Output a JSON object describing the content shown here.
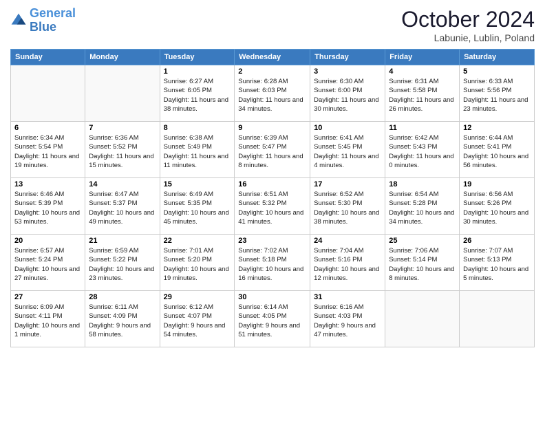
{
  "logo": {
    "line1": "General",
    "line2": "Blue"
  },
  "title": "October 2024",
  "location": "Labunie, Lublin, Poland",
  "weekdays": [
    "Sunday",
    "Monday",
    "Tuesday",
    "Wednesday",
    "Thursday",
    "Friday",
    "Saturday"
  ],
  "weeks": [
    [
      {
        "day": "",
        "info": ""
      },
      {
        "day": "",
        "info": ""
      },
      {
        "day": "1",
        "info": "Sunrise: 6:27 AM\nSunset: 6:05 PM\nDaylight: 11 hours and 38 minutes."
      },
      {
        "day": "2",
        "info": "Sunrise: 6:28 AM\nSunset: 6:03 PM\nDaylight: 11 hours and 34 minutes."
      },
      {
        "day": "3",
        "info": "Sunrise: 6:30 AM\nSunset: 6:00 PM\nDaylight: 11 hours and 30 minutes."
      },
      {
        "day": "4",
        "info": "Sunrise: 6:31 AM\nSunset: 5:58 PM\nDaylight: 11 hours and 26 minutes."
      },
      {
        "day": "5",
        "info": "Sunrise: 6:33 AM\nSunset: 5:56 PM\nDaylight: 11 hours and 23 minutes."
      }
    ],
    [
      {
        "day": "6",
        "info": "Sunrise: 6:34 AM\nSunset: 5:54 PM\nDaylight: 11 hours and 19 minutes."
      },
      {
        "day": "7",
        "info": "Sunrise: 6:36 AM\nSunset: 5:52 PM\nDaylight: 11 hours and 15 minutes."
      },
      {
        "day": "8",
        "info": "Sunrise: 6:38 AM\nSunset: 5:49 PM\nDaylight: 11 hours and 11 minutes."
      },
      {
        "day": "9",
        "info": "Sunrise: 6:39 AM\nSunset: 5:47 PM\nDaylight: 11 hours and 8 minutes."
      },
      {
        "day": "10",
        "info": "Sunrise: 6:41 AM\nSunset: 5:45 PM\nDaylight: 11 hours and 4 minutes."
      },
      {
        "day": "11",
        "info": "Sunrise: 6:42 AM\nSunset: 5:43 PM\nDaylight: 11 hours and 0 minutes."
      },
      {
        "day": "12",
        "info": "Sunrise: 6:44 AM\nSunset: 5:41 PM\nDaylight: 10 hours and 56 minutes."
      }
    ],
    [
      {
        "day": "13",
        "info": "Sunrise: 6:46 AM\nSunset: 5:39 PM\nDaylight: 10 hours and 53 minutes."
      },
      {
        "day": "14",
        "info": "Sunrise: 6:47 AM\nSunset: 5:37 PM\nDaylight: 10 hours and 49 minutes."
      },
      {
        "day": "15",
        "info": "Sunrise: 6:49 AM\nSunset: 5:35 PM\nDaylight: 10 hours and 45 minutes."
      },
      {
        "day": "16",
        "info": "Sunrise: 6:51 AM\nSunset: 5:32 PM\nDaylight: 10 hours and 41 minutes."
      },
      {
        "day": "17",
        "info": "Sunrise: 6:52 AM\nSunset: 5:30 PM\nDaylight: 10 hours and 38 minutes."
      },
      {
        "day": "18",
        "info": "Sunrise: 6:54 AM\nSunset: 5:28 PM\nDaylight: 10 hours and 34 minutes."
      },
      {
        "day": "19",
        "info": "Sunrise: 6:56 AM\nSunset: 5:26 PM\nDaylight: 10 hours and 30 minutes."
      }
    ],
    [
      {
        "day": "20",
        "info": "Sunrise: 6:57 AM\nSunset: 5:24 PM\nDaylight: 10 hours and 27 minutes."
      },
      {
        "day": "21",
        "info": "Sunrise: 6:59 AM\nSunset: 5:22 PM\nDaylight: 10 hours and 23 minutes."
      },
      {
        "day": "22",
        "info": "Sunrise: 7:01 AM\nSunset: 5:20 PM\nDaylight: 10 hours and 19 minutes."
      },
      {
        "day": "23",
        "info": "Sunrise: 7:02 AM\nSunset: 5:18 PM\nDaylight: 10 hours and 16 minutes."
      },
      {
        "day": "24",
        "info": "Sunrise: 7:04 AM\nSunset: 5:16 PM\nDaylight: 10 hours and 12 minutes."
      },
      {
        "day": "25",
        "info": "Sunrise: 7:06 AM\nSunset: 5:14 PM\nDaylight: 10 hours and 8 minutes."
      },
      {
        "day": "26",
        "info": "Sunrise: 7:07 AM\nSunset: 5:13 PM\nDaylight: 10 hours and 5 minutes."
      }
    ],
    [
      {
        "day": "27",
        "info": "Sunrise: 6:09 AM\nSunset: 4:11 PM\nDaylight: 10 hours and 1 minute."
      },
      {
        "day": "28",
        "info": "Sunrise: 6:11 AM\nSunset: 4:09 PM\nDaylight: 9 hours and 58 minutes."
      },
      {
        "day": "29",
        "info": "Sunrise: 6:12 AM\nSunset: 4:07 PM\nDaylight: 9 hours and 54 minutes."
      },
      {
        "day": "30",
        "info": "Sunrise: 6:14 AM\nSunset: 4:05 PM\nDaylight: 9 hours and 51 minutes."
      },
      {
        "day": "31",
        "info": "Sunrise: 6:16 AM\nSunset: 4:03 PM\nDaylight: 9 hours and 47 minutes."
      },
      {
        "day": "",
        "info": ""
      },
      {
        "day": "",
        "info": ""
      }
    ]
  ]
}
